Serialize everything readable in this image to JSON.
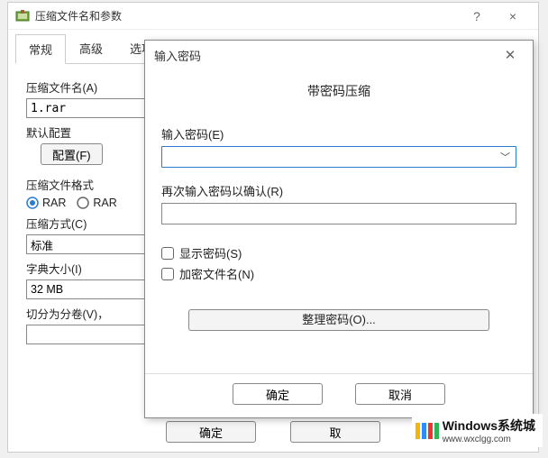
{
  "main": {
    "title": "压缩文件名和参数",
    "help_btn": "?",
    "close_btn": "×",
    "tabs": [
      "常规",
      "高级",
      "选项"
    ],
    "filename_label": "压缩文件名(A)",
    "filename_value": "1.rar",
    "default_profile_label": "默认配置",
    "profile_btn": "配置(F)",
    "format_label": "压缩文件格式",
    "format_rar": "RAR",
    "format_rar4": "RAR",
    "method_label": "压缩方式(C)",
    "method_value": "标准",
    "dict_label": "字典大小(I)",
    "dict_value": "32 MB",
    "split_label": "切分为分卷(V)，",
    "ok": "确定",
    "cancel": "取"
  },
  "pw": {
    "title": "输入密码",
    "heading": "带密码压缩",
    "enter_label": "输入密码(E)",
    "confirm_label": "再次输入密码以确认(R)",
    "show_label": "显示密码(S)",
    "encrypt_label": "加密文件名(N)",
    "organize": "整理密码(O)...",
    "ok": "确定",
    "cancel": "取消"
  },
  "watermark": {
    "text": "Windows系统城",
    "url": "www.wxclgg.com"
  }
}
